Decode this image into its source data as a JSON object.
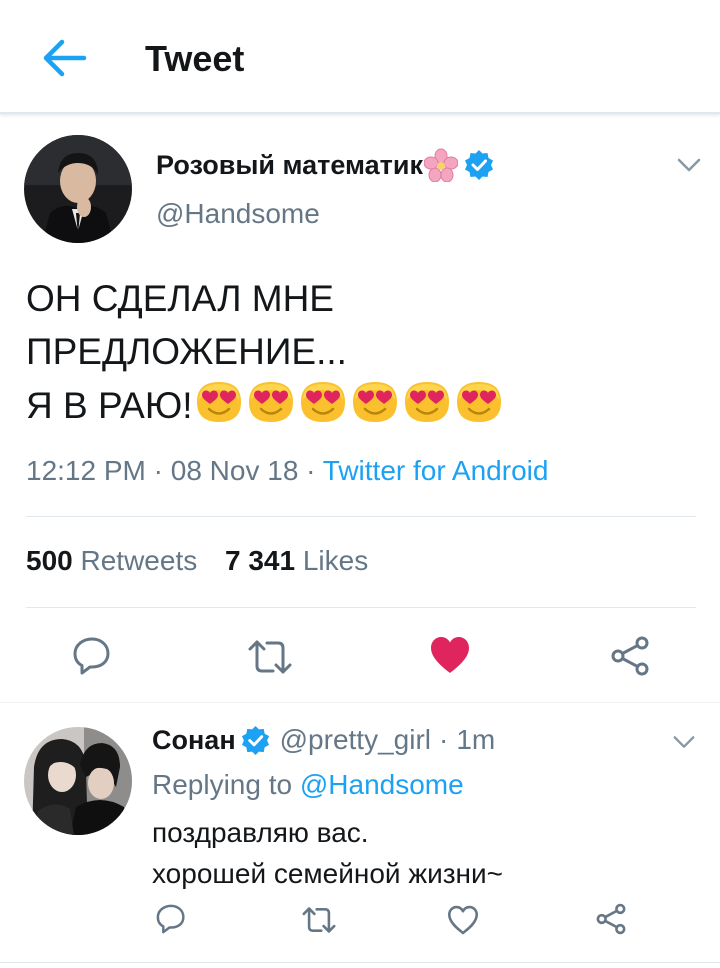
{
  "header": {
    "title": "Tweet"
  },
  "tweet": {
    "author_name": "Розовый математик",
    "author_handle": "@Handsome",
    "text_line1": "ОН СДЕЛАЛ МНЕ",
    "text_line2": "ПРЕДЛОЖЕНИЕ...",
    "text_line3": "Я В РАЮ!",
    "emoji_count": 6,
    "time": "12:12 PM",
    "date": "08 Nov 18",
    "separator": "·",
    "source": "Twitter for Android",
    "retweets_count": "500",
    "retweets_label": "Retweets",
    "likes_count": "7 341",
    "likes_label": "Likes",
    "liked": true
  },
  "reply": {
    "author_name": "Сонан",
    "author_handle": "@pretty_girl",
    "separator": "·",
    "time_ago": "1m",
    "replying_prefix": "Replying to",
    "replying_to": "@Handsome",
    "text_line1": "поздравляю вас.",
    "text_line2": "хорошей семейной жизни~"
  },
  "colors": {
    "accent": "#1da1f2",
    "like": "#e0245e",
    "icon_gray": "#657786",
    "divider": "#e1e8ed",
    "verified": "#1da1f2"
  }
}
